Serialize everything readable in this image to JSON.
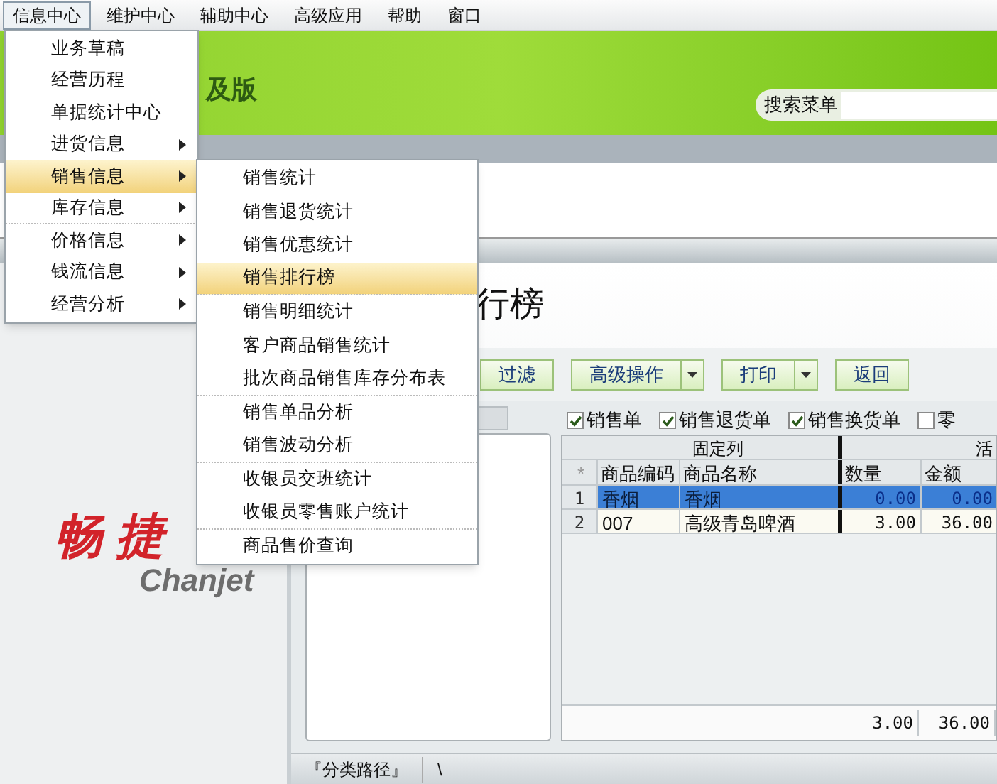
{
  "menubar": [
    {
      "label": "信息中心",
      "selected": true
    },
    {
      "label": "维护中心",
      "selected": false
    },
    {
      "label": "辅助中心",
      "selected": false
    },
    {
      "label": "高级应用",
      "selected": false
    },
    {
      "label": "帮助",
      "selected": false
    },
    {
      "label": "窗口",
      "selected": false
    }
  ],
  "banner": {
    "edition": "及版",
    "search_label": "搜索菜单"
  },
  "logo": {
    "chinese": "畅 捷",
    "latin": "Chanjet"
  },
  "page_title": "行榜",
  "toolbar": [
    {
      "label": "过滤",
      "kind": "plain"
    },
    {
      "label": "高级操作",
      "kind": "split"
    },
    {
      "label": "打印",
      "kind": "split"
    },
    {
      "label": "返回",
      "kind": "plain"
    }
  ],
  "filters": [
    {
      "label": "销售单",
      "checked": true
    },
    {
      "label": "销售退货单",
      "checked": true
    },
    {
      "label": "销售换货单",
      "checked": true
    },
    {
      "label": "零",
      "checked": false
    }
  ],
  "grid": {
    "groups": [
      "固定列",
      "活"
    ],
    "columns": [
      "*",
      "商品编码",
      "商品名称",
      "数量",
      "金额"
    ],
    "rows": [
      {
        "cells": [
          "1",
          "香烟",
          "香烟",
          "0.00",
          "0.00"
        ],
        "selected": true
      },
      {
        "cells": [
          "2",
          "007",
          "高级青岛啤酒",
          "3.00",
          "36.00"
        ],
        "selected": false
      }
    ],
    "totals": [
      "3.00",
      "36.00"
    ]
  },
  "status_bar": {
    "path": "『分类路径』",
    "separator": "\\"
  },
  "menu": [
    {
      "label": "业务草稿",
      "has_submenu": false,
      "selected": false,
      "separator_after": false
    },
    {
      "label": "经营历程",
      "has_submenu": false,
      "selected": false,
      "separator_after": false
    },
    {
      "label": "单据统计中心",
      "has_submenu": false,
      "selected": false,
      "separator_after": false
    },
    {
      "label": "进货信息",
      "has_submenu": true,
      "selected": false,
      "separator_after": false
    },
    {
      "label": "销售信息",
      "has_submenu": true,
      "selected": true,
      "separator_after": false
    },
    {
      "label": "库存信息",
      "has_submenu": true,
      "selected": false,
      "separator_after": true
    },
    {
      "label": "价格信息",
      "has_submenu": true,
      "selected": false,
      "separator_after": false
    },
    {
      "label": "钱流信息",
      "has_submenu": true,
      "selected": false,
      "separator_after": false
    },
    {
      "label": "经营分析",
      "has_submenu": true,
      "selected": false,
      "separator_after": false
    }
  ],
  "submenu": [
    {
      "label": "销售统计",
      "selected": false,
      "separator_after": false
    },
    {
      "label": "销售退货统计",
      "selected": false,
      "separator_after": false
    },
    {
      "label": "销售优惠统计",
      "selected": false,
      "separator_after": false
    },
    {
      "label": "销售排行榜",
      "selected": true,
      "separator_after": true
    },
    {
      "label": "销售明细统计",
      "selected": false,
      "separator_after": false
    },
    {
      "label": "客户商品销售统计",
      "selected": false,
      "separator_after": false
    },
    {
      "label": "批次商品销售库存分布表",
      "selected": false,
      "separator_after": true
    },
    {
      "label": "销售单品分析",
      "selected": false,
      "separator_after": false
    },
    {
      "label": "销售波动分析",
      "selected": false,
      "separator_after": true
    },
    {
      "label": "收银员交班统计",
      "selected": false,
      "separator_after": false
    },
    {
      "label": "收银员零售账户统计",
      "selected": false,
      "separator_after": true
    },
    {
      "label": "商品售价查询",
      "selected": false,
      "separator_after": false
    }
  ]
}
